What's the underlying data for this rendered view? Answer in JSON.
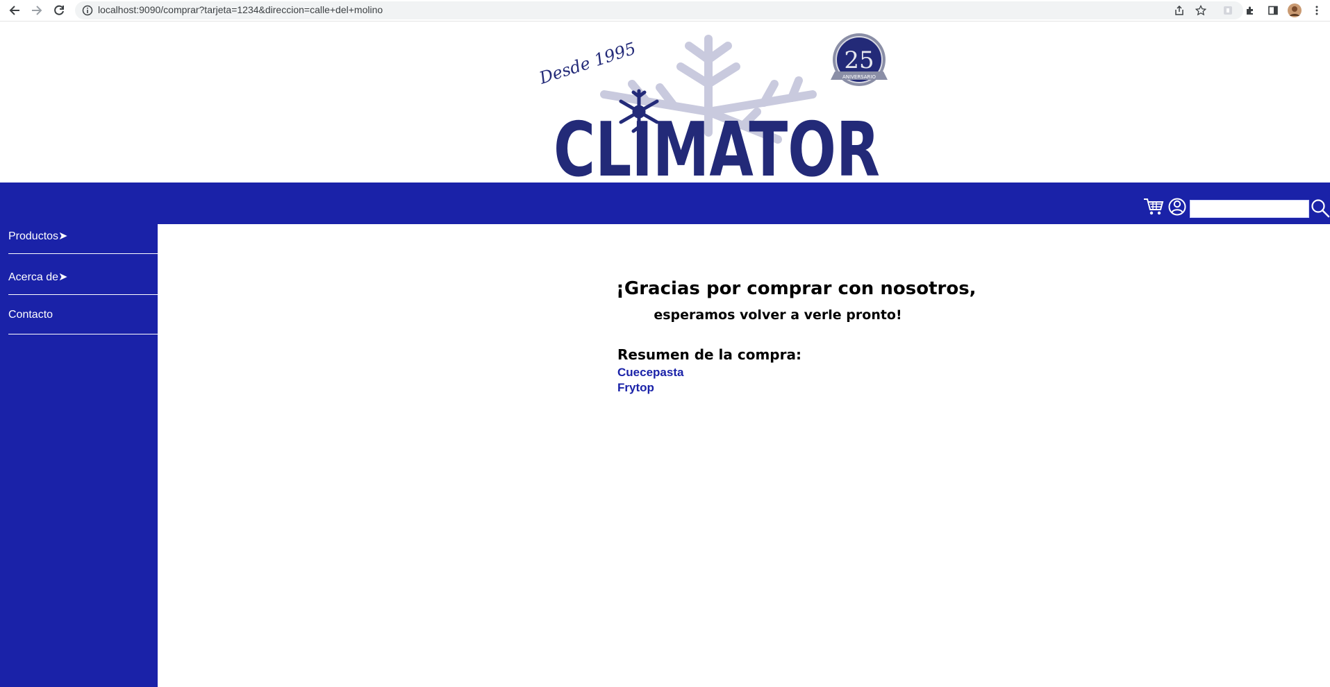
{
  "browser": {
    "url": "localhost:9090/comprar?tarjeta=1234&direccion=calle+del+molino"
  },
  "logo": {
    "tagline": "Desde 1995",
    "brand": "CLIMATOR",
    "anniversary_number": "25",
    "anniversary_label": "ANIVERSARIO"
  },
  "topbar": {
    "search_placeholder": ""
  },
  "sidebar": {
    "items": [
      {
        "label": "Productos➤"
      },
      {
        "label": "Acerca de➤"
      },
      {
        "label": "Contacto"
      }
    ]
  },
  "main": {
    "thanks_line1": "¡Gracias por comprar con nosotros,",
    "thanks_line2": "esperamos volver a verle pronto!",
    "summary_title": "Resumen de la compra:",
    "products": [
      "Cuecepasta",
      "Frytop"
    ]
  },
  "colors": {
    "brand_blue": "#1a22a8",
    "logo_navy": "#232a78",
    "snowflake_light": "#c9cade"
  }
}
